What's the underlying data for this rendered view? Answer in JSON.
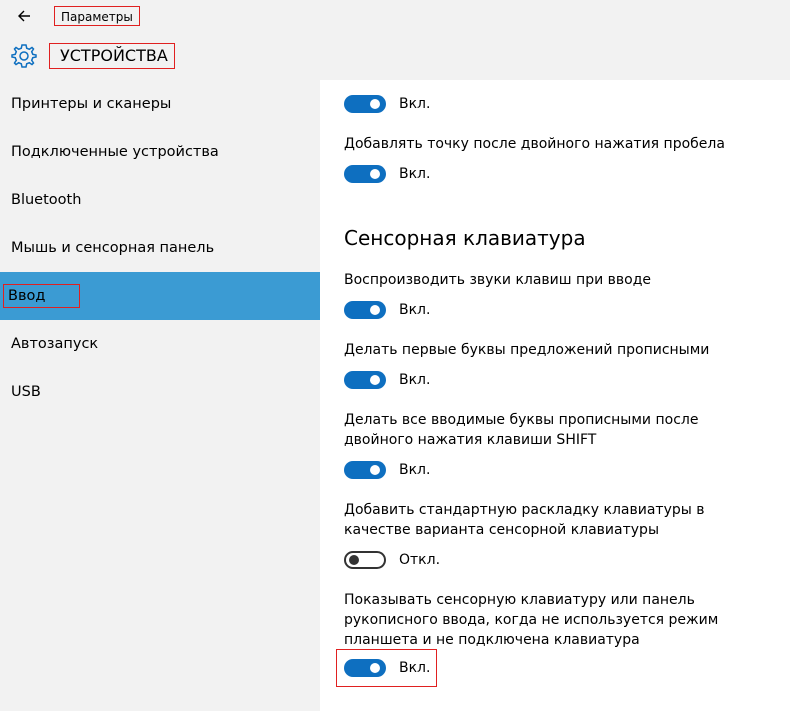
{
  "header": {
    "app_title": "Параметры",
    "section_title": "УСТРОЙСТВА"
  },
  "sidebar": {
    "items": [
      {
        "label": "Принтеры и сканеры",
        "active": false
      },
      {
        "label": "Подключенные устройства",
        "active": false
      },
      {
        "label": "Bluetooth",
        "active": false
      },
      {
        "label": "Мышь и сенсорная панель",
        "active": false
      },
      {
        "label": "Ввод",
        "active": true
      },
      {
        "label": "Автозапуск",
        "active": false
      },
      {
        "label": "USB",
        "active": false
      }
    ]
  },
  "content": {
    "settings_top": [
      {
        "label": "",
        "state": "Вкл.",
        "on": true
      },
      {
        "label": "Добавлять точку после двойного нажатия пробела",
        "state": "Вкл.",
        "on": true
      }
    ],
    "group_title": "Сенсорная клавиатура",
    "settings": [
      {
        "label": "Воспроизводить звуки клавиш при вводе",
        "state": "Вкл.",
        "on": true
      },
      {
        "label": "Делать первые буквы предложений прописными",
        "state": "Вкл.",
        "on": true
      },
      {
        "label": "Делать все вводимые буквы прописными после двойного нажатия клавиши SHIFT",
        "state": "Вкл.",
        "on": true
      },
      {
        "label": "Добавить стандартную раскладку клавиатуры в качестве варианта сенсорной клавиатуры",
        "state": "Откл.",
        "on": false
      },
      {
        "label": "Показывать сенсорную клавиатуру или панель рукописного ввода, когда не используется режим планшета и не подключена клавиатура",
        "state": "Вкл.",
        "on": true
      }
    ]
  },
  "colors": {
    "accent": "#0e6fc0",
    "nav_active": "#3b9bd3",
    "highlight_box": "#e02020",
    "panel_bg": "#f2f2f2"
  }
}
